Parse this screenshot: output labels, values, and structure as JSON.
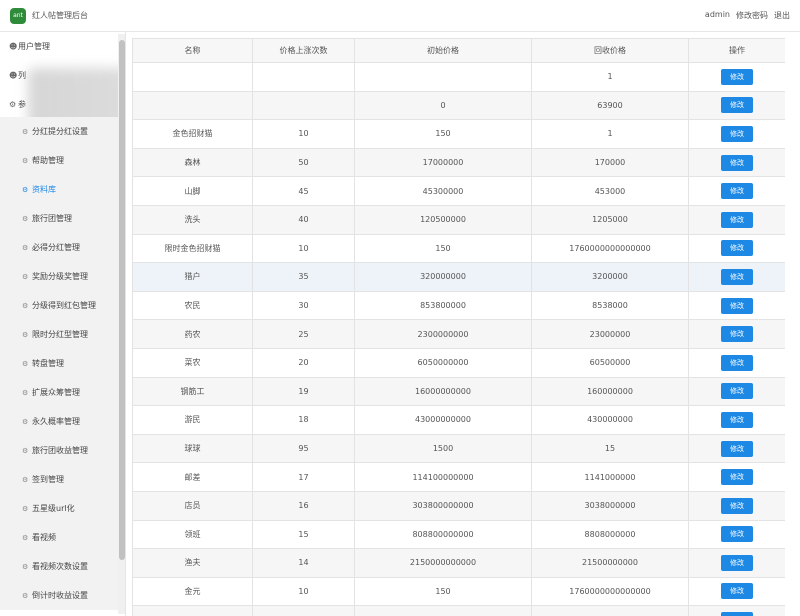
{
  "header": {
    "logo_text": "ant",
    "title": "红人帖管理后台",
    "user": "admin",
    "change_password": "修改密码",
    "logout": "退出"
  },
  "sidebar": {
    "groups": [
      {
        "label": "用户管理",
        "icon": "user-icon"
      },
      {
        "label": "列",
        "icon": "user-icon"
      },
      {
        "label": "参",
        "icon": "gear-icon"
      }
    ],
    "items": [
      {
        "label": "分红提分红设置"
      },
      {
        "label": "帮助管理"
      },
      {
        "label": "资料库"
      },
      {
        "label": "旅行团管理"
      },
      {
        "label": "必得分红管理"
      },
      {
        "label": "奖励分级奖管理"
      },
      {
        "label": "分级得到红包管理"
      },
      {
        "label": "限时分红型管理"
      },
      {
        "label": "转盘管理"
      },
      {
        "label": "扩展众筹管理"
      },
      {
        "label": "永久概率管理"
      },
      {
        "label": "旅行团收益管理"
      },
      {
        "label": "签到管理"
      },
      {
        "label": "五星级url化"
      },
      {
        "label": "看视频"
      },
      {
        "label": "看视频次数设置"
      },
      {
        "label": "倒计时收益设置"
      }
    ]
  },
  "table": {
    "headers": [
      "名称",
      "价格上涨次数",
      "初始价格",
      "回收价格",
      "操作"
    ],
    "edit_label": "修改",
    "rows": [
      [
        "",
        "",
        "",
        "1"
      ],
      [
        "",
        "",
        "0",
        "63900"
      ],
      [
        "金色招财猫",
        "10",
        "150",
        "1"
      ],
      [
        "森林",
        "50",
        "17000000",
        "170000"
      ],
      [
        "山脚",
        "45",
        "45300000",
        "453000"
      ],
      [
        "洗头",
        "40",
        "120500000",
        "1205000"
      ],
      [
        "限时金色招财猫",
        "10",
        "150",
        "1760000000000000"
      ],
      [
        "猎户",
        "35",
        "320000000",
        "3200000"
      ],
      [
        "农民",
        "30",
        "853800000",
        "8538000"
      ],
      [
        "药农",
        "25",
        "2300000000",
        "23000000"
      ],
      [
        "菜农",
        "20",
        "6050000000",
        "60500000"
      ],
      [
        "钢筋工",
        "19",
        "16000000000",
        "160000000"
      ],
      [
        "游民",
        "18",
        "43000000000",
        "430000000"
      ],
      [
        "球球",
        "95",
        "1500",
        "15"
      ],
      [
        "邮差",
        "17",
        "114100000000",
        "1141000000"
      ],
      [
        "店员",
        "16",
        "303800000000",
        "3038000000"
      ],
      [
        "领班",
        "15",
        "808800000000",
        "8808000000"
      ],
      [
        "渔夫",
        "14",
        "2150000000000",
        "21500000000"
      ],
      [
        "金元",
        "10",
        "150",
        "1760000000000000"
      ],
      [
        "",
        "",
        "",
        ""
      ]
    ]
  }
}
